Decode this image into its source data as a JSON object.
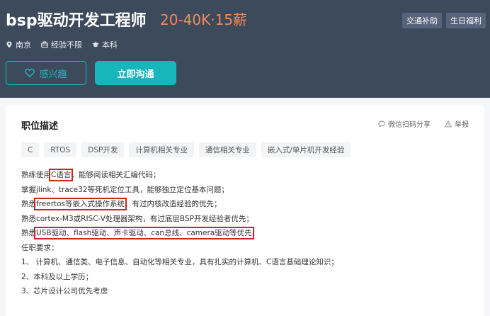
{
  "job": {
    "title": "bsp驱动开发工程师",
    "salary": "20-40K·15薪",
    "benefits": [
      "交通补助",
      "生日福利"
    ],
    "meta": {
      "city": "南京",
      "experience": "经验不限",
      "education": "本科"
    }
  },
  "actions": {
    "interest_label": "感兴趣",
    "chat_label": "立即沟通"
  },
  "card": {
    "section_title": "职位描述",
    "share_label": "微信扫码分享",
    "report_label": "举报",
    "tags": [
      "C",
      "RTOS",
      "DSP开发",
      "计算机相关专业",
      "通信相关专业",
      "嵌入式/单片机开发经验"
    ]
  },
  "description": {
    "line1": {
      "pre": "熟练使用",
      "hl": "C语言",
      "post": "，能够阅读相关汇编代码；"
    },
    "line2": "掌握jlink、trace32等死机定位工具，能够独立定位基本问题；",
    "line3": {
      "pre": "熟悉",
      "hl": "freertos等嵌入式操作系统",
      "post": "，有过内核改造经验的优先；"
    },
    "line4": "熟悉cortex-M3或RISC-V处理器架构，有过底层BSP开发经验者优先；",
    "line5": {
      "pre": "熟悉",
      "hl": "USB驱动、flash驱动、声卡驱动、can总线、camera驱动等优先",
      "post": "；"
    },
    "requirements_title": "任职要求：",
    "req1": "1、 计算机、通信类、电子信息、自动化等相关专业，具有扎实的计算机、C语言基础理论知识；",
    "req2": "2、本科及以上学历；",
    "req3": "3、芯片设计公司优先考虑"
  },
  "colors": {
    "header_bg": "#3d4a5c",
    "salary": "#f2895a",
    "accent": "#17b6bd",
    "highlight_box": "#c3291f"
  },
  "icons": [
    "location-icon",
    "briefcase-icon",
    "graduation-cap-icon",
    "heart-icon",
    "share-icon",
    "warning-icon"
  ]
}
